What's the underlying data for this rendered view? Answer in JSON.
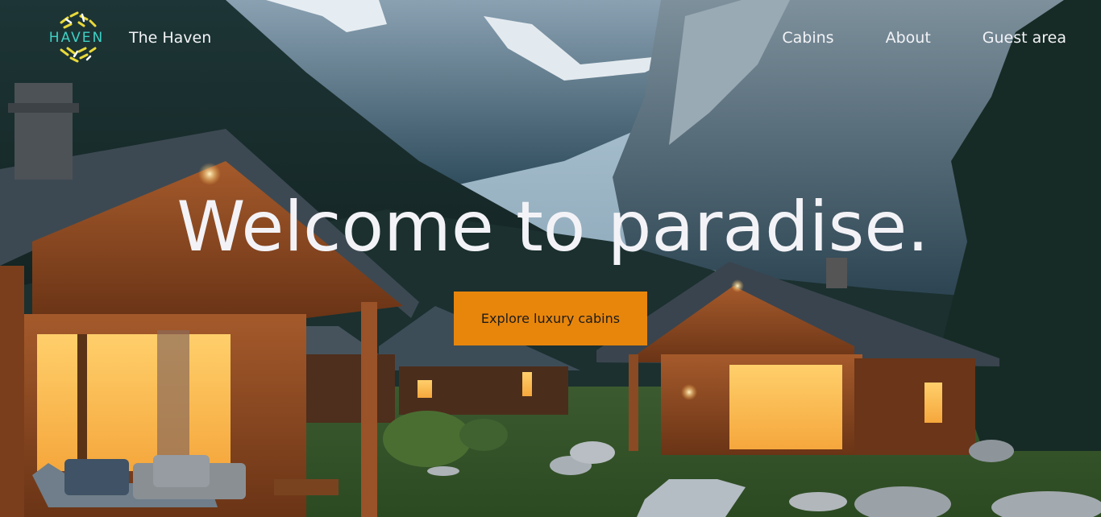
{
  "header": {
    "logo_text": "HAVEN",
    "brand_name": "The Haven",
    "nav": [
      {
        "label": "Cabins"
      },
      {
        "label": "About"
      },
      {
        "label": "Guest area"
      }
    ]
  },
  "hero": {
    "title": "Welcome to paradise.",
    "cta_label": "Explore luxury cabins"
  },
  "colors": {
    "accent": "#e8860c",
    "logo_teal": "#3fd1c5",
    "logo_yellow": "#e9d93a",
    "text_light": "#f2f3f6"
  }
}
